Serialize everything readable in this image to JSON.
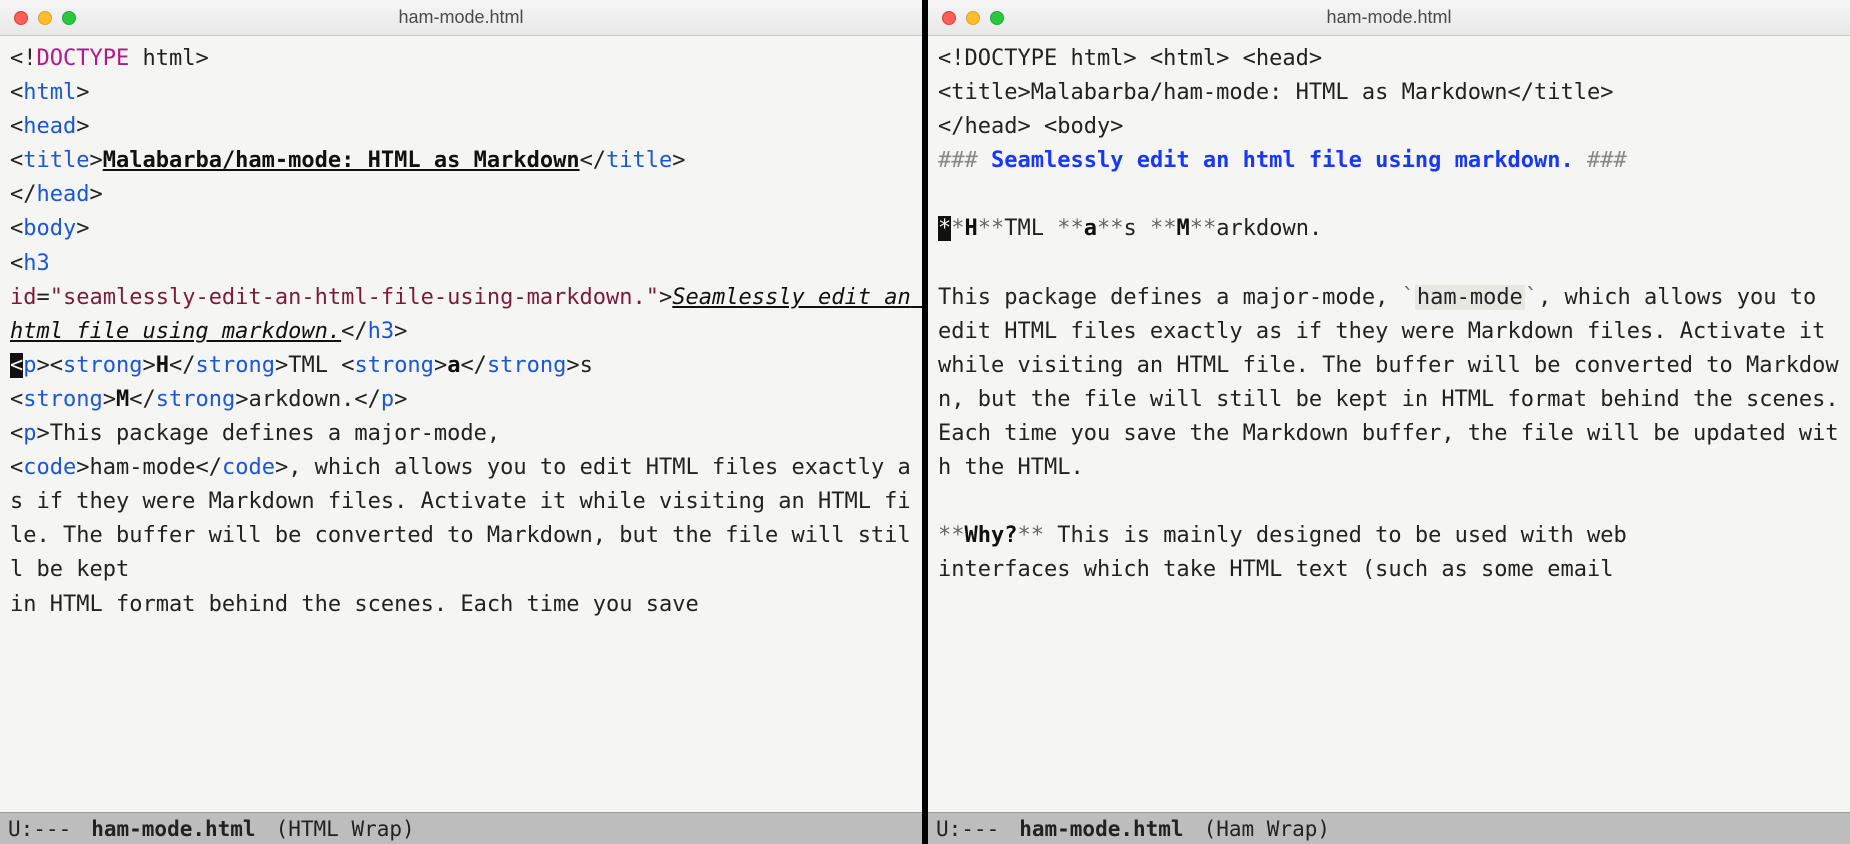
{
  "left": {
    "title": "ham-mode.html",
    "modeline": {
      "status": "U:---",
      "file": "ham-mode.html",
      "mode": "(HTML Wrap)"
    },
    "src": {
      "doctype_open": "<!",
      "doctype_word": "DOCTYPE",
      "doctype_rest": " html>",
      "html_open": "<",
      "html_tag": "html",
      "html_close": ">",
      "head_open": "<",
      "head_tag": "head",
      "head_close": ">",
      "title_open": "<",
      "title_tag": "title",
      "title_close_gt": ">",
      "title_text": "Malabarba/ham-mode: HTML as Markdown",
      "title_end_open": "</",
      "title_end_tag": "title",
      "title_end_close": ">",
      "head_end": "</",
      "head_end_tag": "head",
      "head_end_close": ">",
      "body_open": "<",
      "body_tag": "body",
      "body_close": ">",
      "h3_open": "<",
      "h3_tag": "h3",
      "h3_attr_name": "id",
      "h3_attr_eq": "=",
      "h3_attr_val": "\"seamlessly-edit-an-html-file-using-markdown.\"",
      "h3_gt": ">",
      "h3_text_a": "Seaml",
      "h3_text_b": "essly edit an html file using markdown.",
      "h3_end_open": "</",
      "h3_end_tag": "h3",
      "h3_end_close": ">",
      "p_cursor_lt": "<",
      "p_tag": "p",
      "p_gt": ">",
      "strong_open": "<",
      "strong_tag": "strong",
      "strong_gt": ">",
      "H": "H",
      "strong_end_open": "</",
      "strong_end_close": ">",
      "TML_sp": "TML ",
      "a": "a",
      "s_nl": "s",
      "M": "M",
      "arkdown_p": "arkdown.</",
      "p_end_tag": "p",
      "p_end_gt": ">",
      "para2_open": "<",
      "para2_tag": "p",
      "para2_gt": ">",
      "para2_text_a": "This package defines a major-mode, ",
      "code_open": "<",
      "code_tag": "code",
      "code_gt": ">",
      "code_text": "ham-mode",
      "code_end_open": "</",
      "code_end_close": ">",
      "para2_text_b": ", which allows you to edit HTML files exactly as if they were Markdown files. Activate it while visiting an HTML file. The buffer will be converted to Markdown, but the file will still be kept ",
      "para2_cutoff": "in HTML format behind the scenes. Each time you save"
    }
  },
  "right": {
    "title": "ham-mode.html",
    "modeline": {
      "status": "U:---",
      "file": "ham-mode.html",
      "mode": "(Ham Wrap)"
    },
    "src": {
      "line1": "<!DOCTYPE html> <html> <head>",
      "line2": "<title>Malabarba/ham-mode: HTML as Markdown</title>",
      "line3": "</head> <body>",
      "hashes": "###",
      "header": "Seamlessly edit an html file using markdown.",
      "cursor_star": "*",
      "ast": "*",
      "H": "H",
      "dblast": "**",
      "TML_sp": "TML ",
      "a": "a",
      "s_sp": "s ",
      "M": "M",
      "arkdown_dot": "arkdown.",
      "para": "This package defines a major-mode, ",
      "tick": "`",
      "code": "ham-mode",
      "para_b": ", which allows you to edit HTML files exactly as if they were Markdown files. Activate it while visiting an HTML file. The buffer will be converted to Markdown, but the file will still be kept in HTML format behind the scenes. Each time you save the Markdown buffer, the file will be updated with the HTML.",
      "why_ast": "**",
      "why": "Why?",
      "why_rest": " This is mainly designed to be used with web",
      "cutoff": "interfaces which take HTML text (such as some email"
    }
  }
}
